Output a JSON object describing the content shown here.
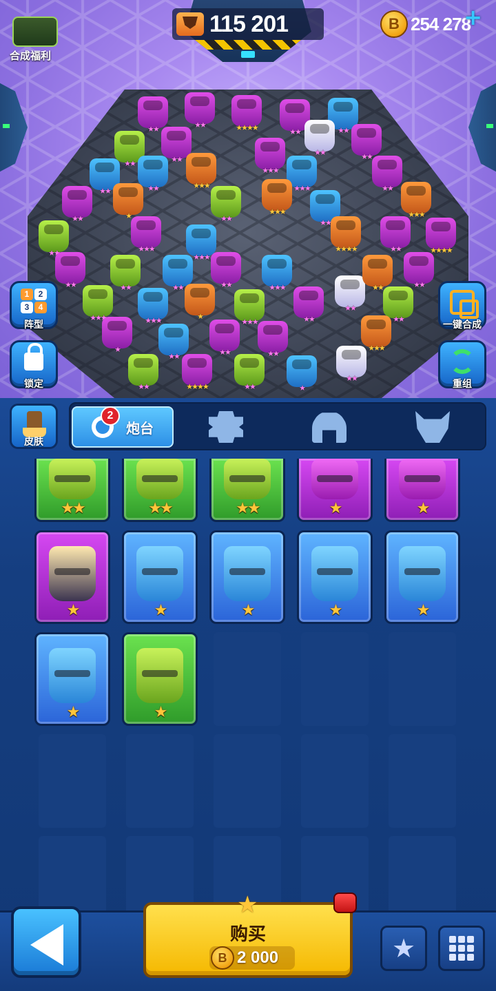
{
  "hud": {
    "trophies": "115 201",
    "coins": "254 278",
    "bonus_label": "合成福利"
  },
  "side_buttons": {
    "formation_label": "阵型",
    "formation_digits": [
      "1",
      "2",
      "3",
      "4"
    ],
    "lock_label": "锁定",
    "merge_label": "一键合成",
    "regroup_label": "重组"
  },
  "panel": {
    "skin_label": "皮肤",
    "tabs": [
      {
        "label": "炮台",
        "badge": "2",
        "active": true,
        "icon": "turret-icon"
      },
      {
        "label": "",
        "icon": "star-gear-icon"
      },
      {
        "label": "",
        "icon": "helmet-icon"
      },
      {
        "label": "",
        "icon": "demon-icon"
      }
    ],
    "cards": [
      {
        "color": "green",
        "stars": "★★"
      },
      {
        "color": "green",
        "stars": "★★"
      },
      {
        "color": "green",
        "stars": "★★"
      },
      {
        "color": "purple",
        "stars": "★"
      },
      {
        "color": "purple",
        "stars": "★"
      },
      {
        "color": "purple",
        "stars": "★"
      },
      {
        "color": "blue",
        "stars": "★"
      },
      {
        "color": "blue",
        "stars": "★"
      },
      {
        "color": "blue",
        "stars": "★"
      },
      {
        "color": "blue",
        "stars": "★"
      },
      {
        "color": "blue",
        "stars": "★"
      },
      {
        "color": "green",
        "stars": "★"
      }
    ]
  },
  "bottom": {
    "buy_label": "购买",
    "buy_price": "2 000"
  },
  "colors": {
    "panel_bg": "#153e80",
    "buy_yellow": "#f5b800",
    "accent_blue": "#2d8fe6",
    "badge_red": "#e0242b",
    "star_gold": "#ffc63a"
  }
}
